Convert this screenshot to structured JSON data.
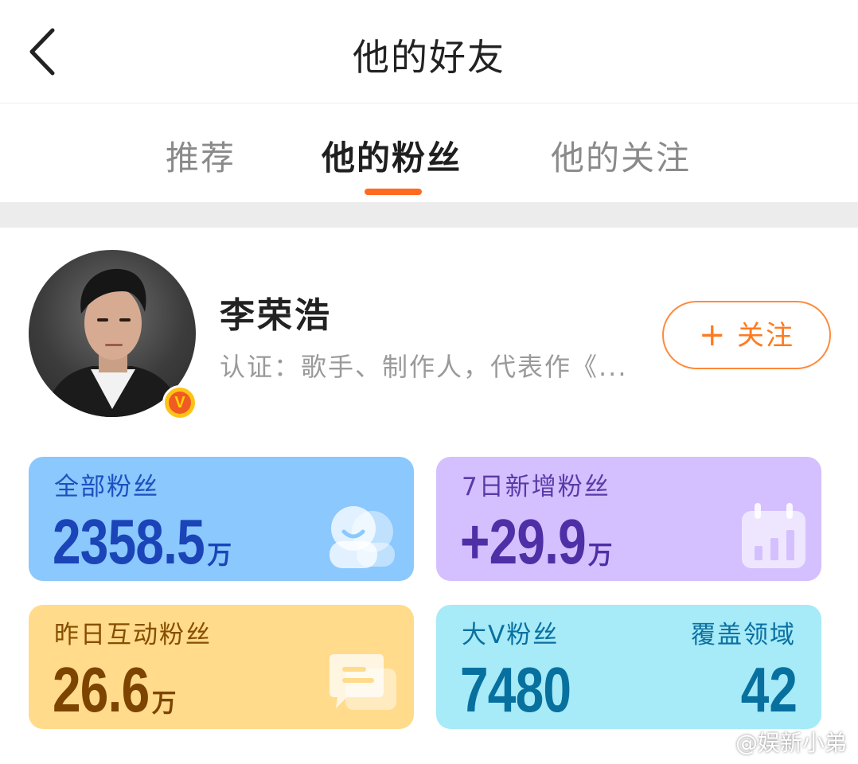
{
  "header": {
    "title": "他的好友",
    "back_icon": "chevron-left-icon"
  },
  "tabs": [
    {
      "label": "推荐",
      "active": false
    },
    {
      "label": "他的粉丝",
      "active": true
    },
    {
      "label": "他的关注",
      "active": false
    }
  ],
  "colors": {
    "accent": "#ff6a1f",
    "follow": "#ff7a1f"
  },
  "profile": {
    "name": "李荣浩",
    "verification": "认证：歌手、制作人，代表作《...",
    "badge": "V",
    "follow_button": {
      "icon": "+",
      "label": "关注"
    }
  },
  "stats": {
    "total_fans": {
      "label": "全部粉丝",
      "value": "2358.5",
      "unit": "万",
      "icon": "users-icon"
    },
    "new_fans_7d": {
      "label": "7日新增粉丝",
      "value": "+29.9",
      "unit": "万",
      "icon": "calendar-chart-icon"
    },
    "interactive_fans_yesterday": {
      "label": "昨日互动粉丝",
      "value": "26.6",
      "unit": "万",
      "icon": "chat-bubble-icon"
    },
    "bigv_fans": {
      "label": "大V粉丝",
      "value": "7480",
      "domain_label": "覆盖领域",
      "domain_value": "42"
    }
  },
  "watermark": "@娱新小弟"
}
